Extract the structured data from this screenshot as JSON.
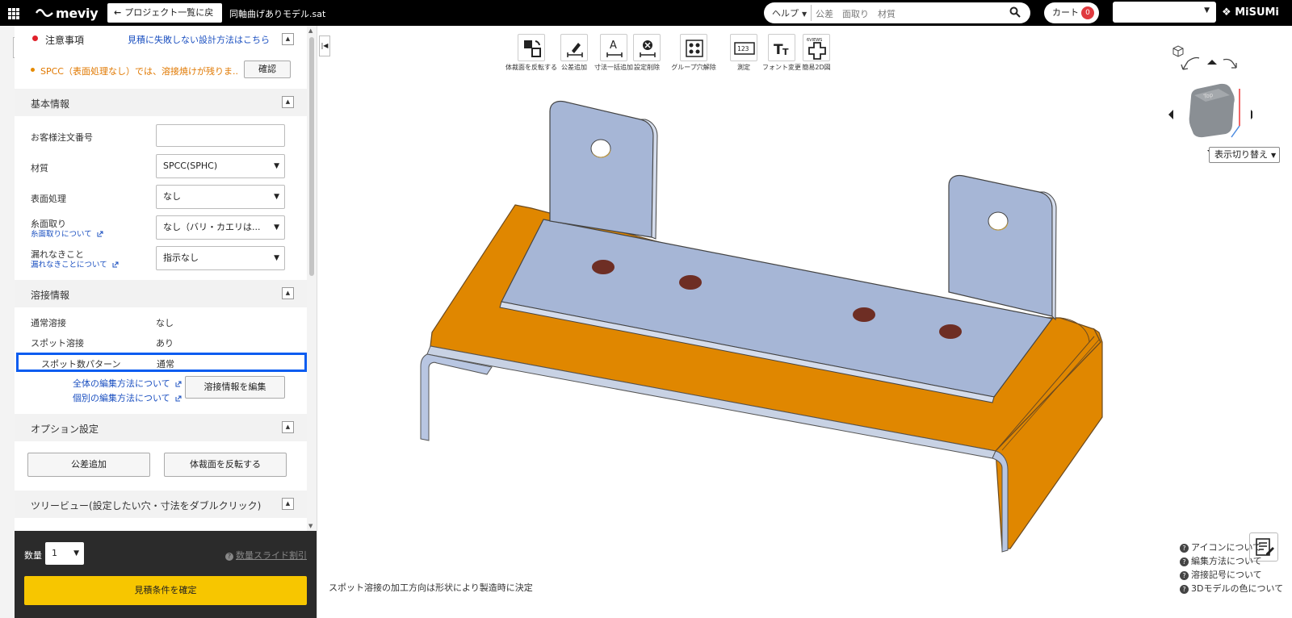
{
  "topbar": {
    "logo": "meviy",
    "back_label": "プロジェクト一覧に戻る",
    "file_title": "同軸曲げありモデル.sat",
    "help_label": "ヘルプ",
    "search_placeholder": "公差　面取り　材質",
    "cart_label": "カート",
    "cart_count": "0",
    "brand": "MiSUMi"
  },
  "notice": {
    "title": "注意事項",
    "link": "見積に失敗しない設計方法はこちら",
    "warning": "SPCC（表面処理なし）では、溶接焼けが残りま...",
    "confirm": "確認"
  },
  "basic": {
    "title": "基本情報",
    "order_no_label": "お客様注文番号",
    "order_no_value": "",
    "material_label": "材質",
    "material_value": "SPCC(SPHC)",
    "surface_label": "表面処理",
    "surface_value": "なし",
    "thread_label": "糸面取り",
    "thread_link": "糸面取りについて",
    "thread_value": "なし（バリ・カエリは...",
    "leak_label": "漏れなきこと",
    "leak_link": "漏れなきことについて",
    "leak_value": "指示なし"
  },
  "weld": {
    "title": "溶接情報",
    "normal_label": "通常溶接",
    "normal_value": "なし",
    "spot_label": "スポット溶接",
    "spot_value": "あり",
    "pattern_label": "スポット数パターン",
    "pattern_value": "通常",
    "edit_all_link": "全体の編集方法について",
    "edit_each_link": "個別の編集方法について",
    "edit_button": "溶接情報を編集"
  },
  "options": {
    "title": "オプション設定",
    "tolerance_button": "公差追加",
    "flip_button": "体裁面を反転する"
  },
  "tree": {
    "title": "ツリービュー(設定したい穴・寸法をダブルクリック)"
  },
  "bottom": {
    "qty_label": "数量",
    "qty_value": "1",
    "slide_discount": "数量スライド割引",
    "confirm_button": "見積条件を確定"
  },
  "toolbar": [
    {
      "label": "体裁面を反転する",
      "icon": "flip-face-icon"
    },
    {
      "label": "公差追加",
      "icon": "tolerance-icon"
    },
    {
      "label": "寸法一括追加",
      "icon": "dimension-icon"
    },
    {
      "label": "設定削除",
      "icon": "delete-setting-icon"
    },
    {
      "label": "グループ穴解除",
      "icon": "hole-group-icon"
    },
    {
      "label": "測定",
      "icon": "measure-icon"
    },
    {
      "label": "フォント変更",
      "icon": "font-icon"
    },
    {
      "label": "簡易2D図",
      "icon": "views-icon"
    }
  ],
  "toolbar_badge": "6VIEWS",
  "viewer": {
    "status": "スポット溶接の加工方向は形状により製造時に決定",
    "view_switch": "表示切り替え",
    "cube_face": "Top",
    "help_links": [
      "アイコンについて",
      "編集方法について",
      "溶接記号について",
      "3Dモデルの色について"
    ]
  },
  "colors": {
    "accent_yellow": "#f7c600",
    "bent_part": "#e08700",
    "flat_part": "#a8b8d8",
    "highlight": "#0a5cf0"
  }
}
